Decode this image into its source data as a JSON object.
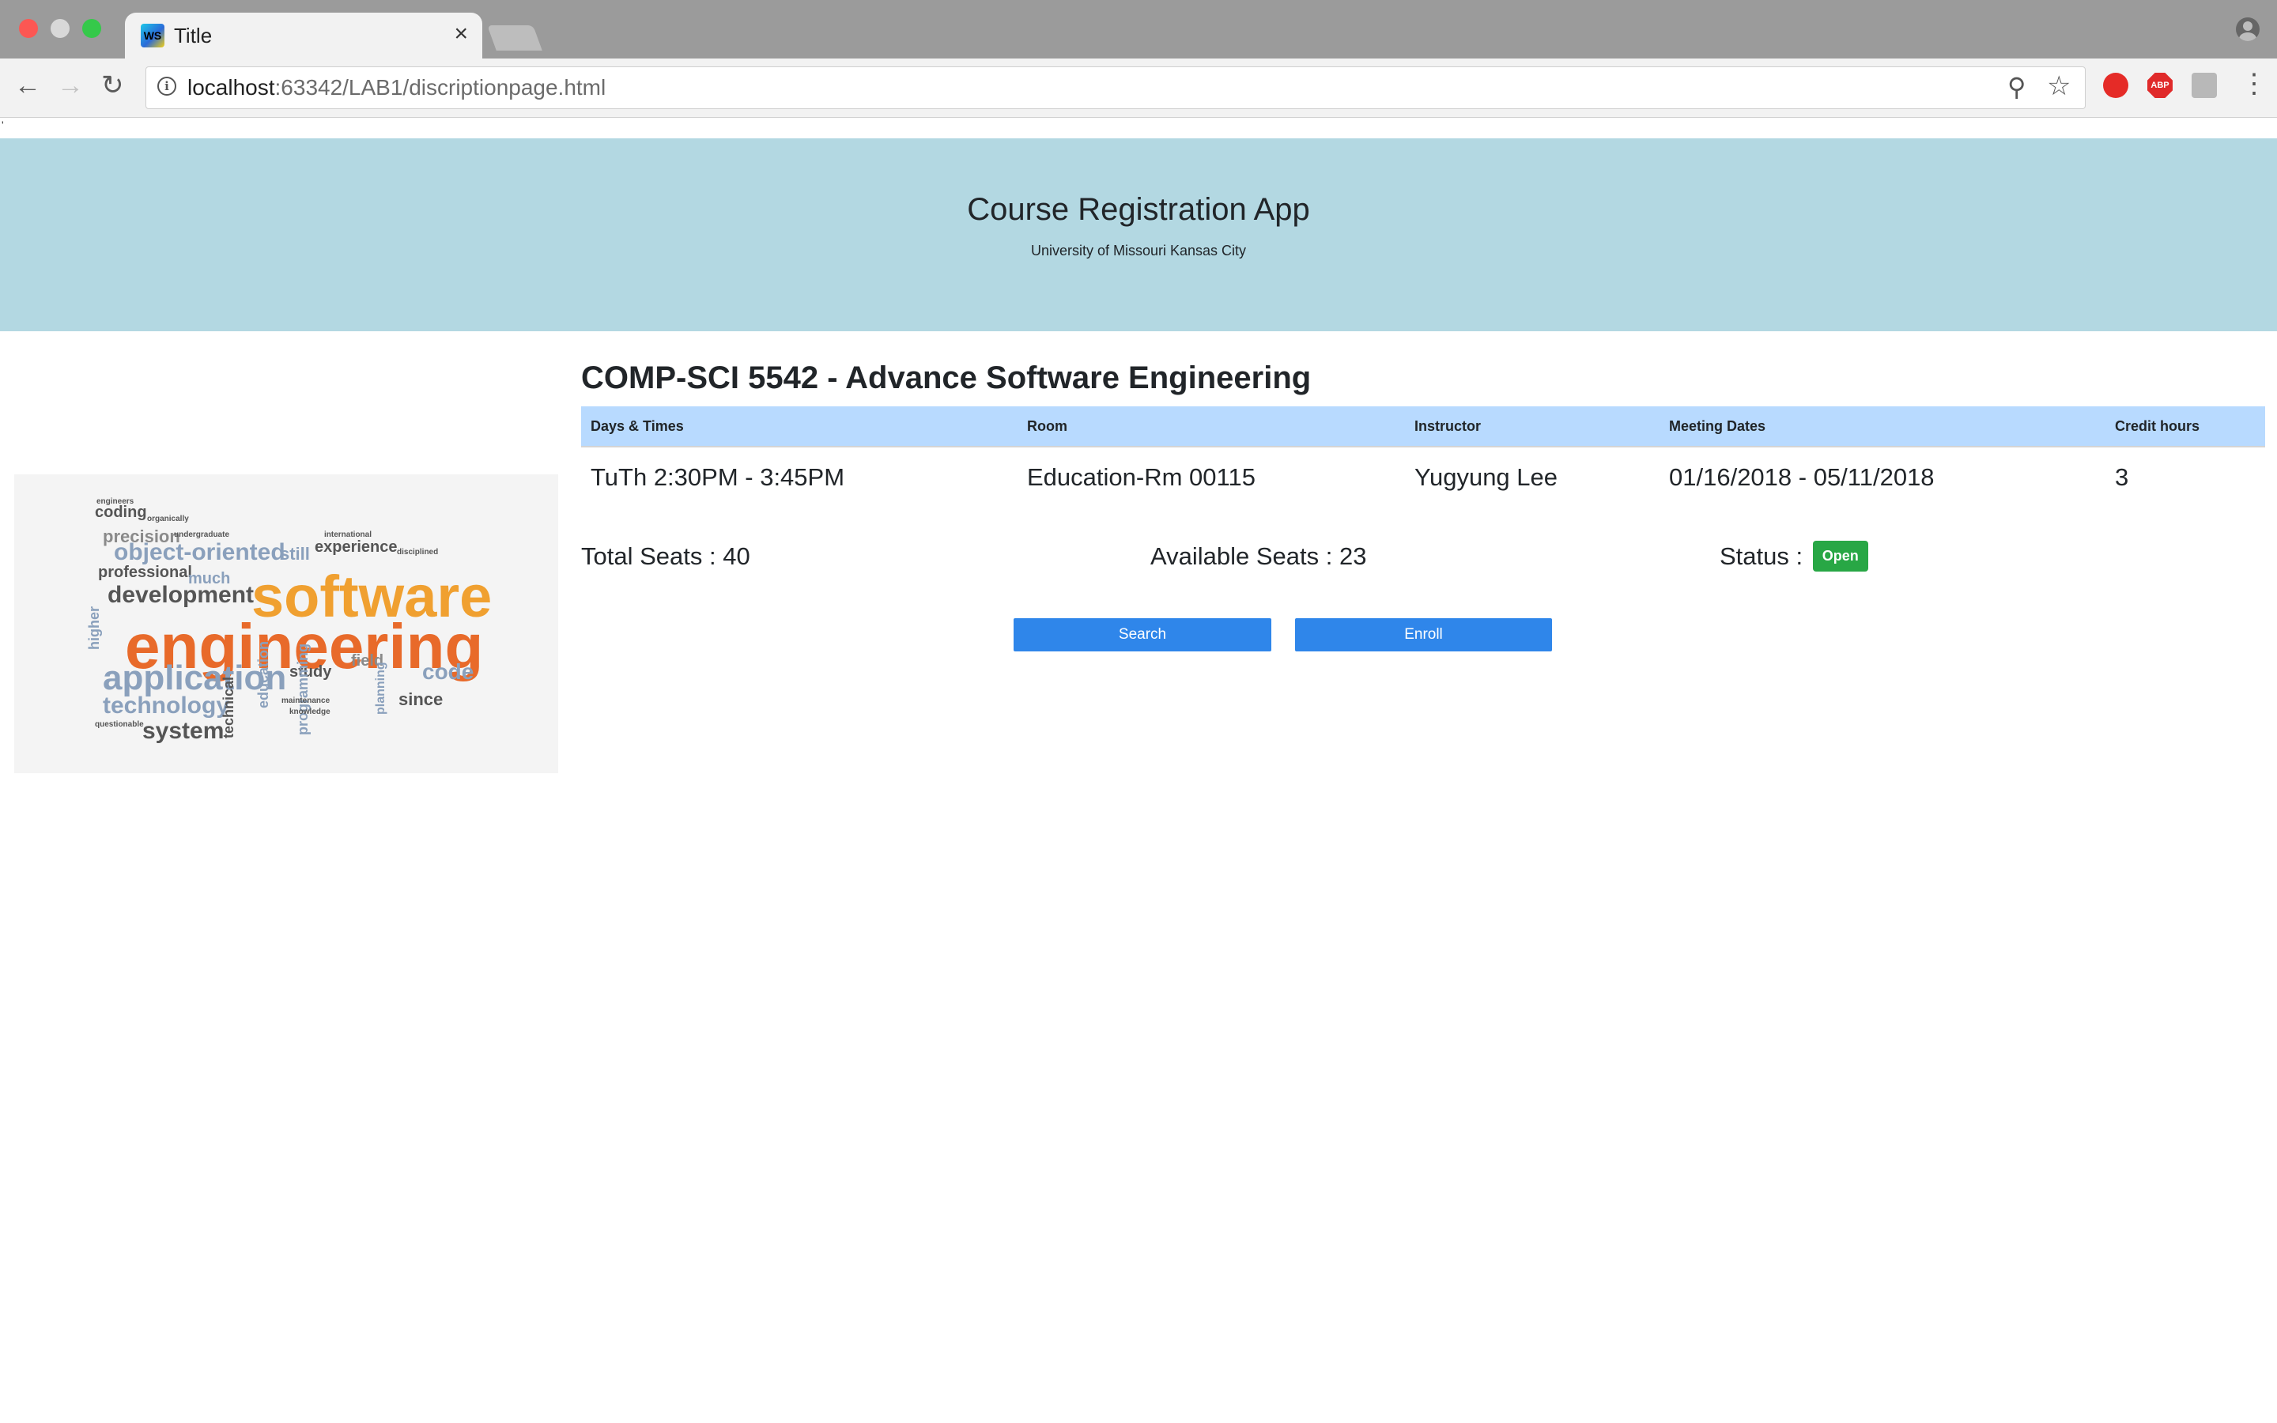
{
  "browser": {
    "tab_title": "Title",
    "tab_favicon": "WS",
    "tab_close": "×",
    "url_host": "localhost",
    "url_rest": ":63342/LAB1/discriptionpage.html",
    "icons": {
      "back": "←",
      "forward": "→",
      "reload": "↻",
      "zoom": "⚲",
      "star": "☆",
      "menu": "⋮",
      "info": "i"
    },
    "extensions": {
      "abp": "ABP"
    }
  },
  "header": {
    "title": "Course Registration App",
    "subtitle": "University of Missouri Kansas City"
  },
  "stray_mark": "'",
  "word_cloud": [
    {
      "text": "software",
      "color": "#f0a030",
      "size": 74
    },
    {
      "text": "engineering",
      "color": "#e86a2a",
      "size": 80
    },
    {
      "text": "application",
      "color": "#8aa0bc",
      "size": 44
    },
    {
      "text": "object-oriented",
      "color": "#8aa0bc",
      "size": 30
    },
    {
      "text": "development",
      "color": "#555555",
      "size": 30
    },
    {
      "text": "technology",
      "color": "#8aa0bc",
      "size": 30
    },
    {
      "text": "system",
      "color": "#555555",
      "size": 30
    },
    {
      "text": "precision",
      "color": "#8a8a8a",
      "size": 22
    },
    {
      "text": "professional",
      "color": "#555555",
      "size": 20
    },
    {
      "text": "coding",
      "color": "#555555",
      "size": 20
    },
    {
      "text": "experience",
      "color": "#555555",
      "size": 20
    },
    {
      "text": "code",
      "color": "#8aa0bc",
      "size": 28
    },
    {
      "text": "since",
      "color": "#555555",
      "size": 22
    },
    {
      "text": "study",
      "color": "#555555",
      "size": 20
    },
    {
      "text": "field",
      "color": "#8a8a8a",
      "size": 20
    },
    {
      "text": "still",
      "color": "#8aa0bc",
      "size": 22
    },
    {
      "text": "much",
      "color": "#8aa0bc",
      "size": 20
    },
    {
      "text": "programming",
      "color": "#8aa0bc",
      "size": 18
    },
    {
      "text": "technical",
      "color": "#555555",
      "size": 18
    },
    {
      "text": "education",
      "color": "#8aa0bc",
      "size": 18
    },
    {
      "text": "planning",
      "color": "#8aa0bc",
      "size": 16
    },
    {
      "text": "higher",
      "color": "#8aa0bc",
      "size": 18
    },
    {
      "text": "engineers",
      "color": "#555555",
      "size": 10
    },
    {
      "text": "organically",
      "color": "#555555",
      "size": 10
    },
    {
      "text": "undergraduate",
      "color": "#555555",
      "size": 10
    },
    {
      "text": "international",
      "color": "#555555",
      "size": 10
    },
    {
      "text": "disciplined",
      "color": "#555555",
      "size": 10
    },
    {
      "text": "maintenance",
      "color": "#555555",
      "size": 10
    },
    {
      "text": "knowledge",
      "color": "#555555",
      "size": 10
    },
    {
      "text": "questionable",
      "color": "#555555",
      "size": 10
    }
  ],
  "course": {
    "title": "COMP-SCI 5542 - Advance Software Engineering",
    "columns": [
      "Days & Times",
      "Room",
      "Instructor",
      "Meeting Dates",
      "Credit hours"
    ],
    "row": [
      "TuTh 2:30PM - 3:45PM",
      "Education-Rm 00115",
      "Yugyung Lee",
      "01/16/2018 - 05/11/2018",
      "3"
    ]
  },
  "seats": {
    "total": "Total Seats : 40",
    "available": "Available Seats : 23",
    "status_label": "Status :",
    "status_badge": "Open"
  },
  "actions": {
    "search": "Search",
    "enroll": "Enroll"
  },
  "colors": {
    "header_bg": "#b3d8e2",
    "table_head_bg": "#b8daff",
    "button_bg": "#2f86ea",
    "badge_bg": "#28a745"
  }
}
